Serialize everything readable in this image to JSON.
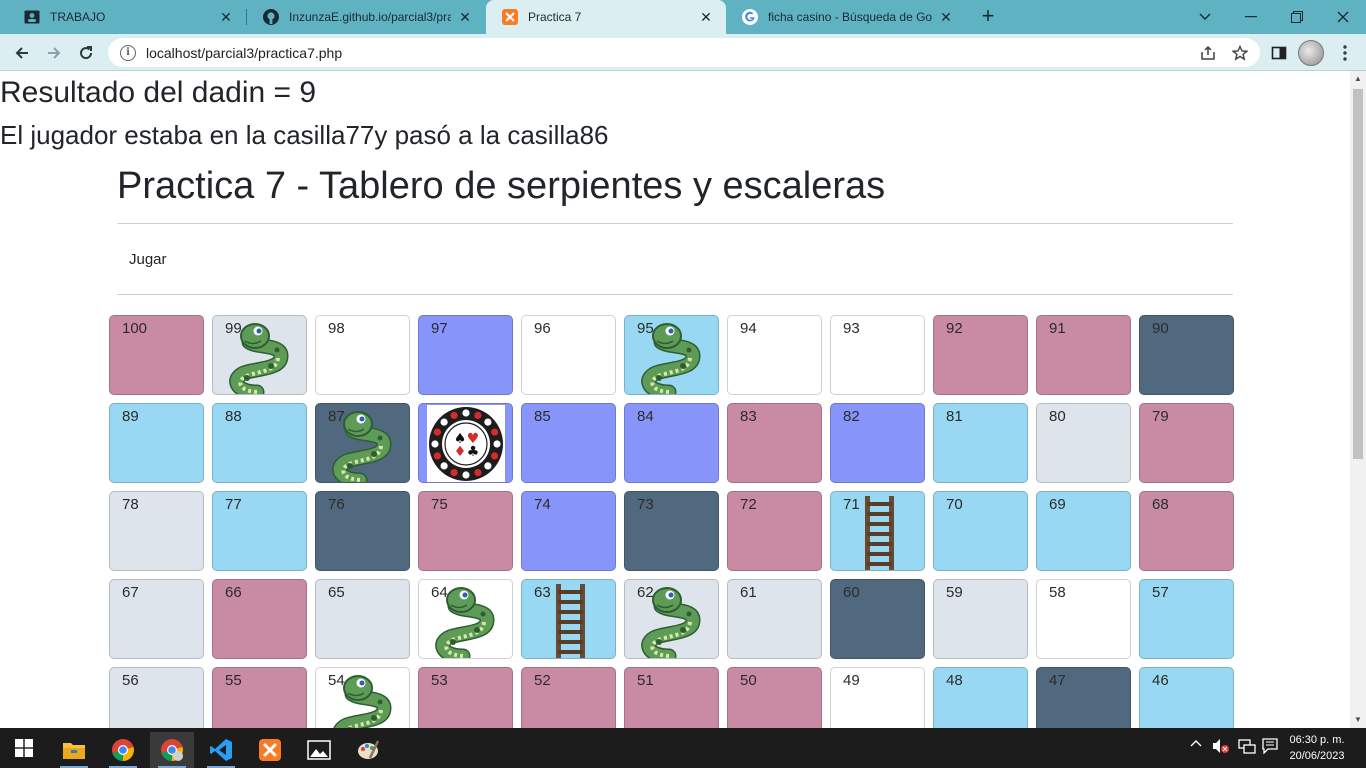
{
  "browser": {
    "tabs": [
      {
        "title": "TRABAJO",
        "icon": "profile-card-icon",
        "active": false
      },
      {
        "title": "InzunzaE.github.io/parcial3/practi",
        "icon": "github-icon",
        "active": false
      },
      {
        "title": "Practica 7",
        "icon": "xampp-icon",
        "active": true
      },
      {
        "title": "ficha casino - Búsqueda de Goog",
        "icon": "google-icon",
        "active": false
      }
    ],
    "url": "localhost/parcial3/practica7.php"
  },
  "page": {
    "result_line": "Resultado del dadin = 9",
    "moved_line": "El jugador estaba en la casilla77y pasó a la casilla86",
    "title": "Practica 7 - Tablero de serpientes y escaleras",
    "play_link": "Jugar"
  },
  "colors": {
    "pink": "#c98ba4",
    "gray": "#dde4ec",
    "white": "#ffffff",
    "periwinkle": "#8794fa",
    "sky": "#99d8f2",
    "slate": "#51697f"
  },
  "board": {
    "rows": [
      [
        {
          "n": "100",
          "color": "pink"
        },
        {
          "n": "99",
          "color": "gray",
          "piece": "snake"
        },
        {
          "n": "98",
          "color": "white"
        },
        {
          "n": "97",
          "color": "periwinkle"
        },
        {
          "n": "96",
          "color": "white"
        },
        {
          "n": "95",
          "color": "sky",
          "piece": "snake"
        },
        {
          "n": "94",
          "color": "white"
        },
        {
          "n": "93",
          "color": "white"
        },
        {
          "n": "92",
          "color": "pink"
        },
        {
          "n": "91",
          "color": "pink"
        },
        {
          "n": "90",
          "color": "slate"
        }
      ],
      [
        {
          "n": "89",
          "color": "sky"
        },
        {
          "n": "88",
          "color": "sky"
        },
        {
          "n": "87",
          "color": "slate",
          "piece": "snake"
        },
        {
          "n": "86",
          "color": "periwinkle",
          "piece": "chip"
        },
        {
          "n": "85",
          "color": "periwinkle"
        },
        {
          "n": "84",
          "color": "periwinkle"
        },
        {
          "n": "83",
          "color": "pink"
        },
        {
          "n": "82",
          "color": "periwinkle"
        },
        {
          "n": "81",
          "color": "sky"
        },
        {
          "n": "80",
          "color": "gray"
        },
        {
          "n": "79",
          "color": "pink"
        }
      ],
      [
        {
          "n": "78",
          "color": "gray"
        },
        {
          "n": "77",
          "color": "sky"
        },
        {
          "n": "76",
          "color": "slate"
        },
        {
          "n": "75",
          "color": "pink"
        },
        {
          "n": "74",
          "color": "periwinkle"
        },
        {
          "n": "73",
          "color": "slate"
        },
        {
          "n": "72",
          "color": "pink"
        },
        {
          "n": "71",
          "color": "sky",
          "piece": "ladder"
        },
        {
          "n": "70",
          "color": "sky"
        },
        {
          "n": "69",
          "color": "sky"
        },
        {
          "n": "68",
          "color": "pink"
        }
      ],
      [
        {
          "n": "67",
          "color": "gray"
        },
        {
          "n": "66",
          "color": "pink"
        },
        {
          "n": "65",
          "color": "gray"
        },
        {
          "n": "64",
          "color": "white",
          "piece": "snake"
        },
        {
          "n": "63",
          "color": "sky",
          "piece": "ladder"
        },
        {
          "n": "62",
          "color": "gray",
          "piece": "snake"
        },
        {
          "n": "61",
          "color": "gray"
        },
        {
          "n": "60",
          "color": "slate"
        },
        {
          "n": "59",
          "color": "gray"
        },
        {
          "n": "58",
          "color": "white"
        },
        {
          "n": "57",
          "color": "sky"
        }
      ],
      [
        {
          "n": "56",
          "color": "gray"
        },
        {
          "n": "55",
          "color": "pink"
        },
        {
          "n": "54",
          "color": "white",
          "piece": "snake"
        },
        {
          "n": "53",
          "color": "pink"
        },
        {
          "n": "52",
          "color": "pink"
        },
        {
          "n": "51",
          "color": "pink"
        },
        {
          "n": "50",
          "color": "pink"
        },
        {
          "n": "49",
          "color": "white"
        },
        {
          "n": "48",
          "color": "sky"
        },
        {
          "n": "47",
          "color": "slate"
        },
        {
          "n": "46",
          "color": "sky"
        }
      ]
    ]
  },
  "taskbar": {
    "time": "06:30 p. m.",
    "date": "20/06/2023",
    "apps": [
      "file-explorer-icon",
      "chrome-icon",
      "chrome-profile-icon",
      "vscode-icon",
      "xampp-icon",
      "photos-icon",
      "paint-icon"
    ]
  }
}
